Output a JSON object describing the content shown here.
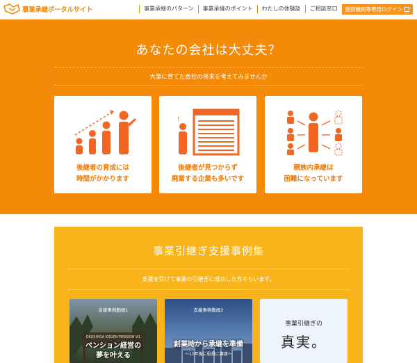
{
  "header": {
    "logo_text": "事業承継ポータルサイト",
    "nav": [
      {
        "label": "事業承継のパターン"
      },
      {
        "label": "事業承継のポイント"
      },
      {
        "label": "わたしの体験談"
      },
      {
        "label": "ご相談窓口"
      }
    ],
    "login_label": "登録機関等専用ログイン"
  },
  "hero": {
    "title": "あなたの会社は大丈夫？",
    "subtitle": "大事に育てた会社の将来を考えてみませんか",
    "cards": [
      {
        "line1": "後継者の育成には",
        "line2": "時間がかかります",
        "icon": "growth-people-icon"
      },
      {
        "line1": "後継者が見つからず",
        "line2": "廃業する企業も多いです",
        "icon": "closed-shop-icon"
      },
      {
        "line1": "親族内承継は",
        "line2": "困難になっています",
        "icon": "family-relations-icon"
      }
    ]
  },
  "cases": {
    "title": "事業引継ぎ支援事例集",
    "subtitle": "支援を受けて事業の引継ぎに成功した方々もいます。",
    "items": [
      {
        "label": "支援事例動画1",
        "caption_line1": "ペンション経営の",
        "caption_line2": "夢を叶える",
        "sign": "OKUSHIGA KOGEN PENSION VIL"
      },
      {
        "label": "支援事例動画2",
        "caption_line1": "創業時から承継を準備",
        "caption_line2": "〜10年後に役員に譲渡〜"
      },
      {
        "top": "事業引継ぎの",
        "main": "真実。"
      }
    ]
  },
  "colors": {
    "accent": "#f58a08",
    "cases_bg": "#fab41b",
    "icon": "#f26522"
  }
}
